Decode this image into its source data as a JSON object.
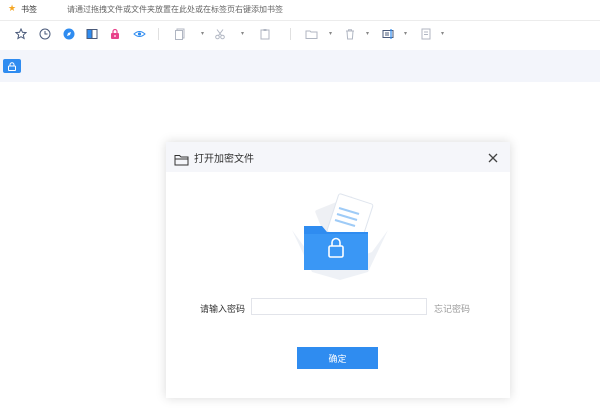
{
  "bookmark_bar": {
    "label": "书签",
    "hint": "请通过拖拽文件或文件夹放置在此处或在标签页右键添加书签"
  },
  "toolbar": {
    "icons": [
      "star-icon",
      "clock-icon",
      "compass-icon",
      "split-view-icon",
      "lock-icon",
      "eye-icon",
      "copy-icon",
      "cut-icon",
      "paste-icon",
      "folder-icon",
      "trash-icon",
      "rename-icon",
      "properties-icon"
    ]
  },
  "dialog": {
    "title": "打开加密文件",
    "password_label": "请输入密码",
    "password_value": "",
    "forgot_label": "忘记密码",
    "confirm_label": "确定"
  },
  "colors": {
    "accent": "#2f8cf0",
    "tab_strip": "#f3f5fb",
    "dialog_header": "#f5f6fa"
  }
}
